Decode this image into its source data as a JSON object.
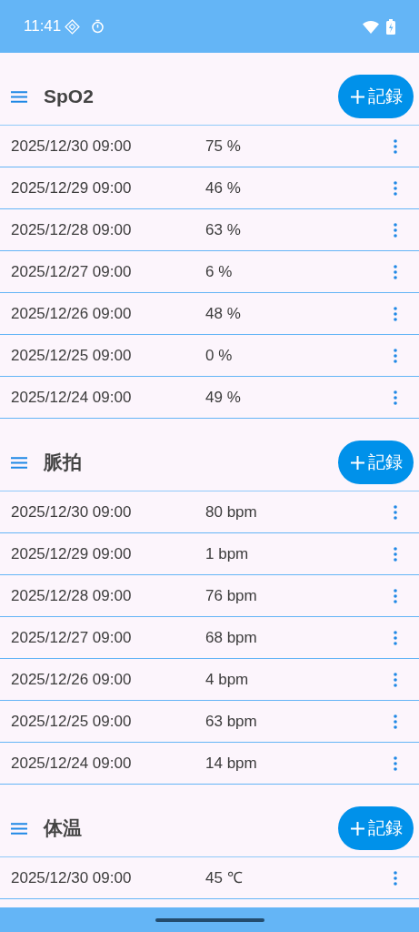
{
  "status_bar": {
    "time": "11:41"
  },
  "sections": [
    {
      "title": "SpO2",
      "add_label": "記録",
      "rows": [
        {
          "datetime": "2025/12/30 09:00",
          "value": "75 %"
        },
        {
          "datetime": "2025/12/29 09:00",
          "value": "46 %"
        },
        {
          "datetime": "2025/12/28 09:00",
          "value": "63 %"
        },
        {
          "datetime": "2025/12/27 09:00",
          "value": "6 %"
        },
        {
          "datetime": "2025/12/26 09:00",
          "value": "48 %"
        },
        {
          "datetime": "2025/12/25 09:00",
          "value": "0 %"
        },
        {
          "datetime": "2025/12/24 09:00",
          "value": "49 %"
        }
      ]
    },
    {
      "title": "脈拍",
      "add_label": "記録",
      "rows": [
        {
          "datetime": "2025/12/30 09:00",
          "value": "80 bpm"
        },
        {
          "datetime": "2025/12/29 09:00",
          "value": "1 bpm"
        },
        {
          "datetime": "2025/12/28 09:00",
          "value": "76 bpm"
        },
        {
          "datetime": "2025/12/27 09:00",
          "value": "68 bpm"
        },
        {
          "datetime": "2025/12/26 09:00",
          "value": "4 bpm"
        },
        {
          "datetime": "2025/12/25 09:00",
          "value": "63 bpm"
        },
        {
          "datetime": "2025/12/24 09:00",
          "value": "14 bpm"
        }
      ]
    },
    {
      "title": "体温",
      "add_label": "記録",
      "rows": [
        {
          "datetime": "2025/12/30 09:00",
          "value": "45 ℃"
        }
      ]
    }
  ]
}
